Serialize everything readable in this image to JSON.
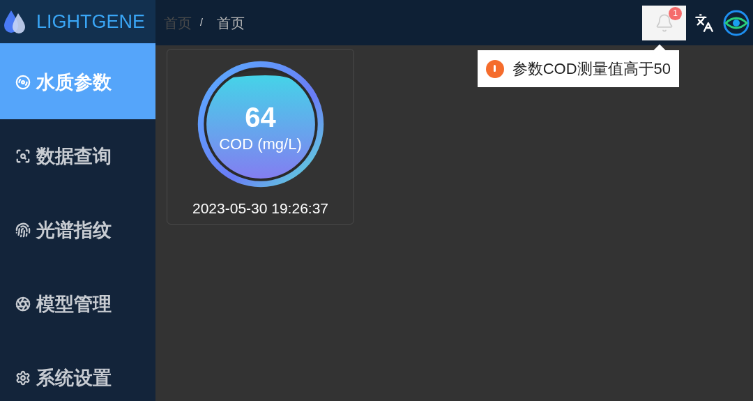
{
  "header": {
    "logo_text": "LIGHTGENE",
    "breadcrumb": [
      "首页",
      "/",
      "首页"
    ],
    "notifications": {
      "count": "1"
    },
    "alert": {
      "message": "参数COD测量值高于50"
    }
  },
  "sidebar": {
    "items": [
      {
        "label": "水质参数",
        "selected": true
      },
      {
        "label": "数据查询",
        "selected": false
      },
      {
        "label": "光谱指纹",
        "selected": false
      },
      {
        "label": "模型管理",
        "selected": false
      },
      {
        "label": "系统设置",
        "selected": false
      }
    ]
  },
  "cards": [
    {
      "value": "64",
      "unit": "COD (mg/L)",
      "timestamp": "2023-05-30 19:26:37"
    }
  ]
}
